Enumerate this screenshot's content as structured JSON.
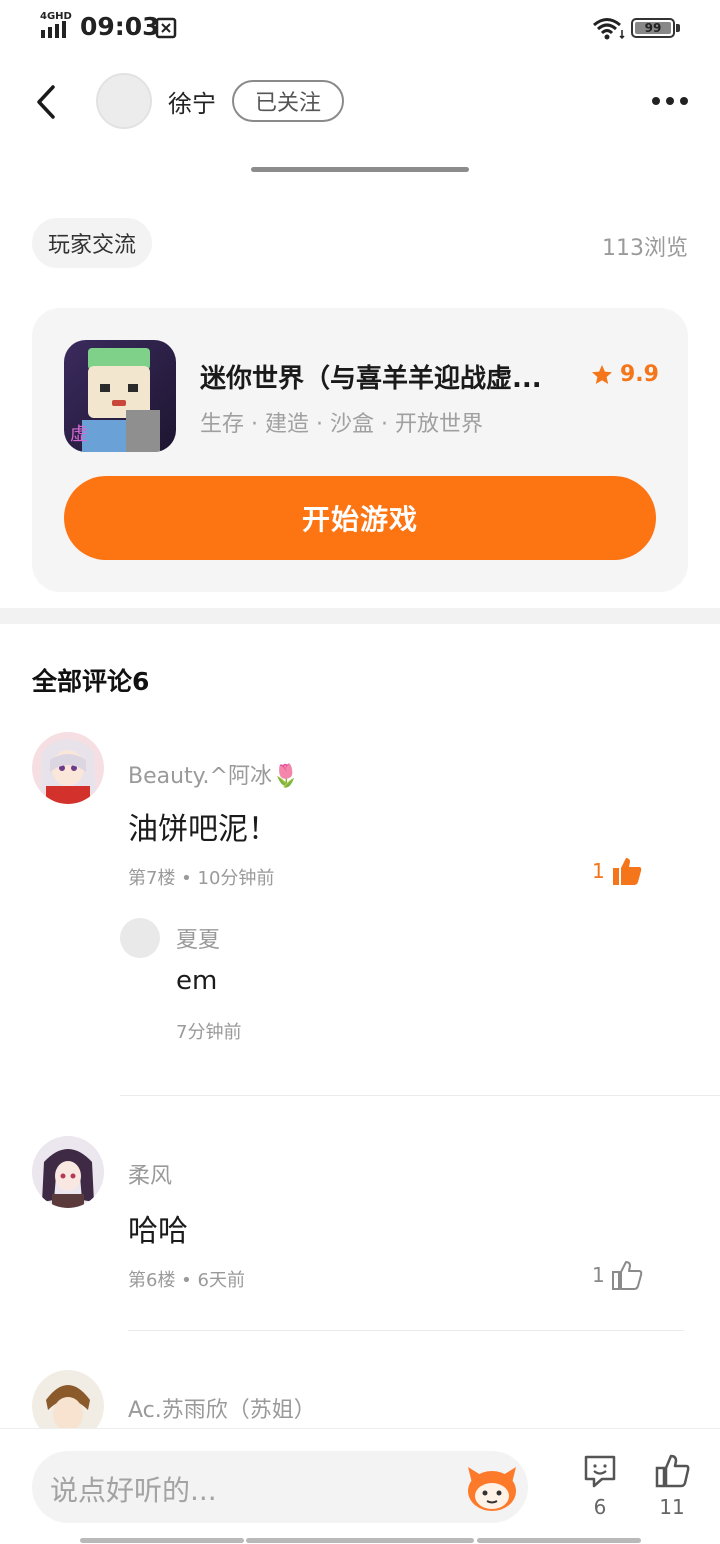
{
  "status_bar": {
    "network": "4GHD",
    "time": "09:03",
    "battery": "99"
  },
  "header": {
    "author_name": "徐宁",
    "follow_label": "已关注"
  },
  "post": {
    "tag": "玩家交流",
    "views": "113浏览"
  },
  "game_card": {
    "title": "迷你世界（与喜羊羊迎战虚...",
    "rating": "9.9",
    "tags": "生存 · 建造 · 沙盒 · 开放世界",
    "play_label": "开始游戏",
    "accent": "#fd7413"
  },
  "comments": {
    "header": "全部评论6",
    "items": [
      {
        "name": "Beauty.^阿冰🌷",
        "text": "油饼吧泥！",
        "meta": "第7楼 • 10分钟前",
        "likes": "1",
        "liked": true,
        "replies": [
          {
            "name": "夏夏",
            "text": "em",
            "time": "7分钟前"
          }
        ]
      },
      {
        "name": "柔风",
        "text": "哈哈",
        "meta": "第6楼 • 6天前",
        "likes": "1",
        "liked": false
      },
      {
        "name": "Ac.苏雨欣（苏姐）"
      }
    ]
  },
  "bottom_bar": {
    "input_placeholder": "说点好听的...",
    "comment_count": "6",
    "like_count": "11"
  },
  "icons": {
    "back": "chevron-left-icon",
    "more": "more-dots-icon",
    "star": "star-icon",
    "thumb": "thumb-up-icon",
    "comment": "comment-bubble-icon",
    "emoji": "emoji-icon"
  }
}
